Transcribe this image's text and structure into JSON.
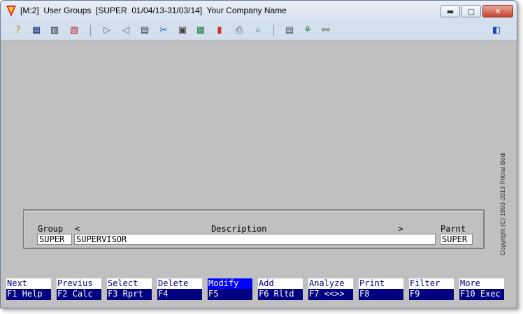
{
  "window": {
    "title": "[M:2]  User Groups  [SUPER  01/04/13-31/03/14]  Your Company Name",
    "minimize_glyph": "▬",
    "maximize_glyph": "▢",
    "close_glyph": "✕"
  },
  "toolbar": {
    "icons": [
      {
        "name": "help-icon",
        "glyph": "?",
        "color": "#c08000"
      },
      {
        "name": "grid-icon",
        "glyph": "▦",
        "color": "#203080"
      },
      {
        "name": "table-icon",
        "glyph": "▥",
        "color": "#202020"
      },
      {
        "name": "chart-doc-icon",
        "glyph": "▧",
        "color": "#c02020"
      },
      {
        "name": "next-arrow-icon",
        "glyph": "▷",
        "color": "#606060"
      },
      {
        "name": "prev-arrow-icon",
        "glyph": "◁",
        "color": "#606060"
      },
      {
        "name": "settings-doc-icon",
        "glyph": "▤",
        "color": "#404040"
      },
      {
        "name": "tools-icon",
        "glyph": "✂",
        "color": "#1060c0"
      },
      {
        "name": "document-icon",
        "glyph": "▣",
        "color": "#404040"
      },
      {
        "name": "calculator-icon",
        "glyph": "▩",
        "color": "#208040"
      },
      {
        "name": "bar-chart-icon",
        "glyph": "▮",
        "color": "#d03020"
      },
      {
        "name": "printer-icon",
        "glyph": "⎙",
        "color": "#303030"
      },
      {
        "name": "search-icon",
        "glyph": "⌕",
        "color": "#206080"
      },
      {
        "name": "clipboard-icon",
        "glyph": "▤",
        "color": "#505050"
      },
      {
        "name": "tree-icon",
        "glyph": "⚘",
        "color": "#208040"
      },
      {
        "name": "users-icon",
        "glyph": "⚯",
        "color": "#406040"
      },
      {
        "name": "exit-icon",
        "glyph": "◧",
        "color": "#2040c0"
      }
    ]
  },
  "copyright": "Copyright  (C)  1993-2013  Pritnal Bedi",
  "form": {
    "group_label": "Group",
    "description_header": "<                          Description                          >",
    "parent_label": "Parnt",
    "group_value": "SUPER",
    "description_value": "SUPERVISOR",
    "parent_value": "SUPER"
  },
  "fkeys": [
    {
      "action": "Next",
      "key": "F1 Help"
    },
    {
      "action": "Previus",
      "key": "F2 Calc"
    },
    {
      "action": "Select",
      "key": "F3 Rprt"
    },
    {
      "action": "Delete",
      "key": "F4"
    },
    {
      "action": "Modify",
      "key": "F5",
      "active": true
    },
    {
      "action": "Add",
      "key": "F6 Rltd"
    },
    {
      "action": "Analyze",
      "key": "F7 <<>>"
    },
    {
      "action": "Print",
      "key": "F8"
    },
    {
      "action": "Filter",
      "key": "F9"
    },
    {
      "action": "More",
      "key": "F10 Exec"
    }
  ]
}
